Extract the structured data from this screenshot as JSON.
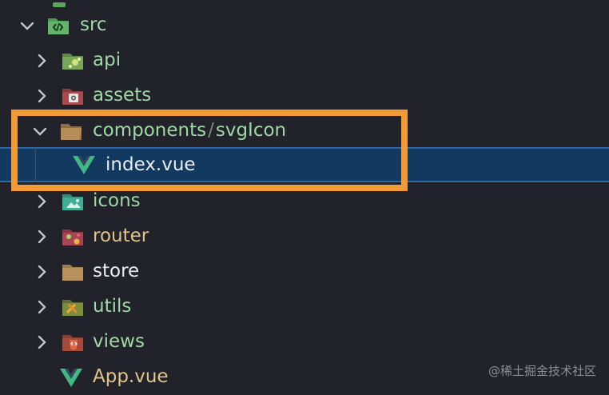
{
  "tree": {
    "items": [
      {
        "label": "src",
        "icon": "folder-source-icon",
        "expanded": true
      },
      {
        "label": "api",
        "icon": "folder-api-icon",
        "expanded": false
      },
      {
        "label": "assets",
        "icon": "folder-assets-icon",
        "expanded": false
      },
      {
        "label": "components",
        "secondary": "svgIcon",
        "icon": "folder-icon",
        "expanded": true
      },
      {
        "label": "index.vue",
        "icon": "vue-icon",
        "selected": true
      },
      {
        "label": "icons",
        "icon": "folder-icons-icon",
        "expanded": false
      },
      {
        "label": "router",
        "icon": "folder-router-icon",
        "expanded": false
      },
      {
        "label": "store",
        "icon": "folder-icon",
        "expanded": false
      },
      {
        "label": "utils",
        "icon": "folder-utils-icon",
        "expanded": false
      },
      {
        "label": "views",
        "icon": "folder-views-icon",
        "expanded": false
      },
      {
        "label": "App.vue",
        "icon": "vue-icon"
      }
    ]
  },
  "watermark": "@稀土掘金技术社区",
  "colors": {
    "background": "#22232a",
    "selected_row": "#123a61",
    "selected_border": "#2d67a8",
    "highlight_box": "#f29a36",
    "green_text": "#9fd7a5",
    "gold_text": "#e1c48a",
    "white_text": "#e9ecf2"
  }
}
